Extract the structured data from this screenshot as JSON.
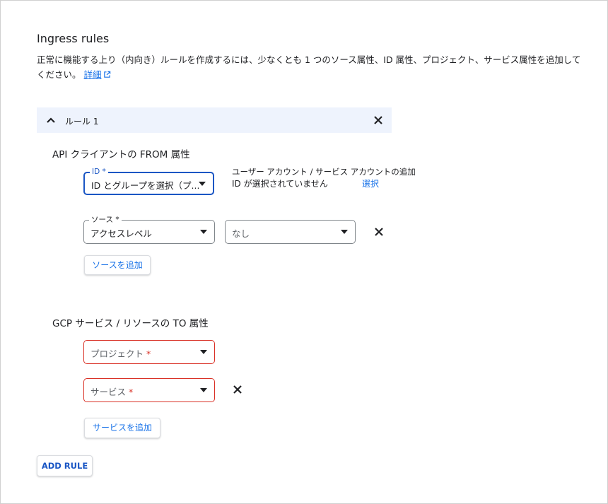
{
  "page": {
    "title": "Ingress rules",
    "description": "正常に機能する上り（内向き）ルールを作成するには、少なくとも 1 つのソース属性、ID 属性、プロジェクト、サービス属性を追加してください。",
    "details_link": "詳細"
  },
  "rule": {
    "label": "ルール 1"
  },
  "from_section": {
    "title": "API クライアントの FROM 属性",
    "id_field": {
      "legend": "ID *",
      "value": "ID とグループを選択（プ..."
    },
    "account_info": {
      "heading": "ユーザー アカウント / サービス アカウントの追加",
      "status": "ID が選択されていません",
      "select_link": "選択"
    },
    "source_field": {
      "legend": "ソース *",
      "value": "アクセスレベル"
    },
    "access_level_field": {
      "placeholder": "なし"
    },
    "add_source_button": "ソースを追加"
  },
  "to_section": {
    "title": "GCP サービス / リソースの TO 属性",
    "project_field": {
      "placeholder": "プロジェクト",
      "required_mark": "*"
    },
    "service_field": {
      "placeholder": "サービス",
      "required_mark": "*"
    },
    "add_service_button": "サービスを追加"
  },
  "add_rule_button": "ADD RULE",
  "colors": {
    "accent": "#1a73e8",
    "focus": "#1a56c4",
    "error": "#d93025",
    "header_bg": "#eef3fd"
  }
}
